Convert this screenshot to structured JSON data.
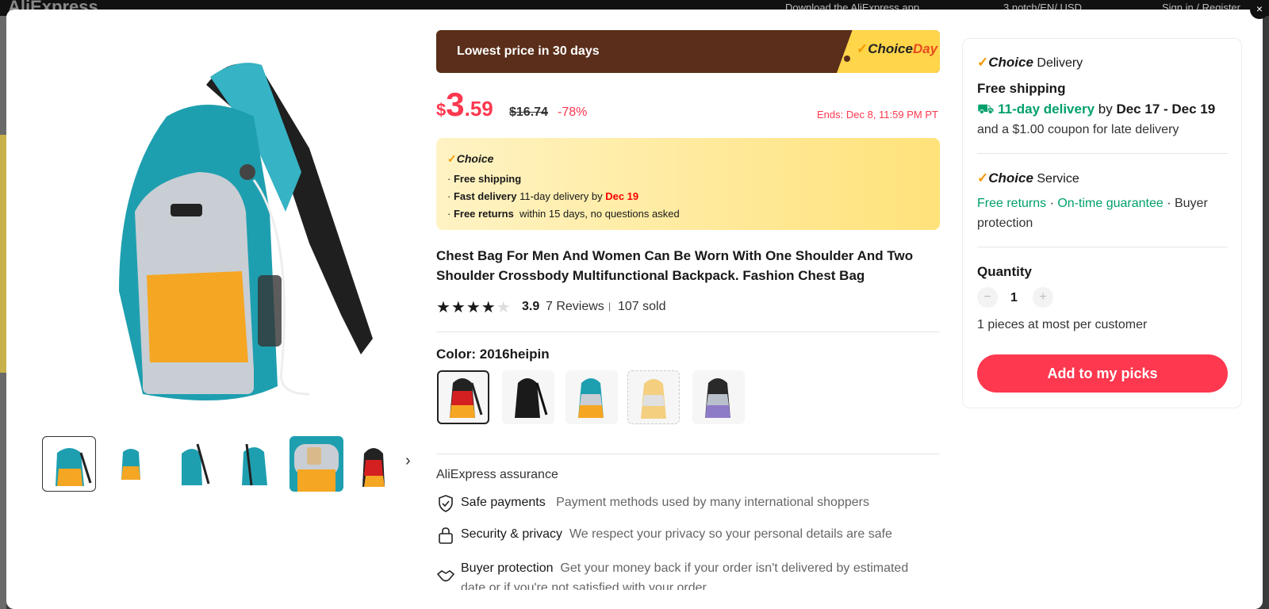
{
  "background": {
    "logo": "AliExpress",
    "download_text": "Download the AliExpress app",
    "locale": "3 notch/EN/ USD",
    "signin": "Sign in / Register"
  },
  "close_label": "×",
  "banner": {
    "text": "Lowest price in 30 days",
    "tag_choice": "Choice",
    "tag_day": "Day"
  },
  "price": {
    "currency": "$",
    "integer": "3",
    "decimal": ".59",
    "original": "$16.74",
    "discount": "-78%",
    "ends": "Ends: Dec 8, 11:59 PM PT"
  },
  "choice_box": {
    "title": "Choice",
    "free_shipping": "Free shipping",
    "fast_delivery_label": "Fast delivery",
    "fast_delivery_text": " 11-day delivery by ",
    "fast_delivery_date": "Dec 19",
    "free_returns_label": "Free returns",
    "free_returns_text": "  within 15 days, no questions asked"
  },
  "product": {
    "title": "Chest Bag For Men And Women Can Be Worn With One Shoulder And Two Shoulder Crossbody Multifunctional Backpack. Fashion Chest Bag",
    "rating": 3.9,
    "rating_text": "3.9",
    "reviews": "7 Reviews",
    "sold": "107 sold",
    "color_label": "Color: 2016heipin"
  },
  "gallery": {
    "next_arrow": "›",
    "thumbnails": [
      "teal-orange-front",
      "teal-orange-small",
      "teal-side",
      "teal-back",
      "teal-closeup",
      "red-black"
    ]
  },
  "swatches": [
    "2016heipin",
    "black",
    "teal-orange",
    "beige",
    "black-purple"
  ],
  "assurance": {
    "title": "AliExpress assurance",
    "items": [
      {
        "name": "Safe payments",
        "desc": "Payment methods used by many international shoppers"
      },
      {
        "name": "Security & privacy",
        "desc": "We respect your privacy so your personal details are safe"
      },
      {
        "name": "Buyer protection",
        "desc": "Get your money back if your order isn't delivered by estimated date or if you're not satisfied with your order"
      }
    ]
  },
  "delivery": {
    "choice": "Choice",
    "title": " Delivery",
    "free_shipping": "Free shipping",
    "days": "11-day delivery",
    "by": " by ",
    "dates": "Dec 17 - Dec 19",
    "coupon": "and a $1.00 coupon for late delivery"
  },
  "service": {
    "choice": "Choice",
    "title": " Service",
    "free_returns": "Free returns",
    "dot1": " · ",
    "on_time": "On-time guarantee",
    "buyer1": " · Buyer",
    "buyer2": "protection"
  },
  "quantity": {
    "label": "Quantity",
    "minus": "−",
    "value": "1",
    "plus": "+",
    "limit": "1 pieces at most per customer"
  },
  "add_button": "Add to my picks",
  "colors": {
    "accent": "#fd384f",
    "green": "#00a06c",
    "banner_bg": "#5a2e1a",
    "choice_yellow": "#ffd54a"
  }
}
